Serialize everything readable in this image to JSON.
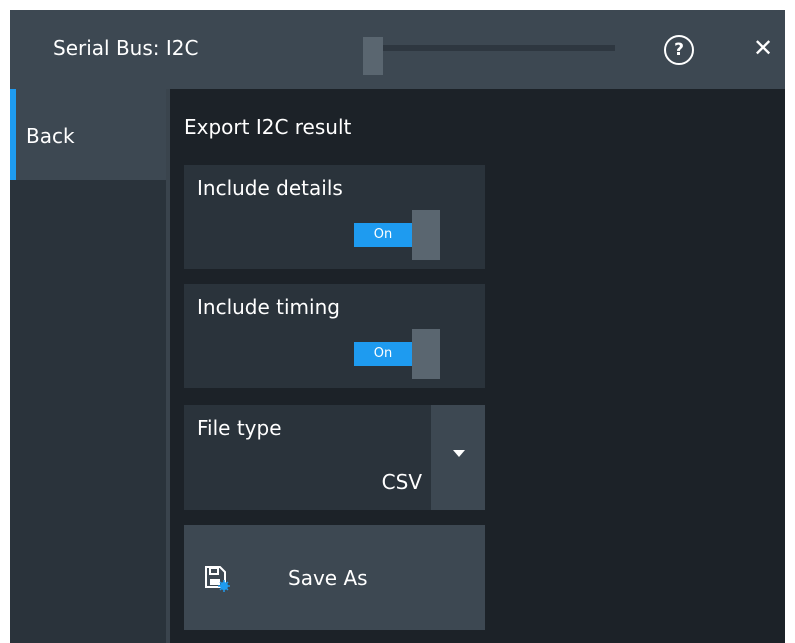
{
  "dialog": {
    "title": "Serial Bus: I2C",
    "help_icon": "help-icon",
    "help_glyph": "?",
    "close_icon": "close-icon",
    "close_glyph": "✕"
  },
  "nav": {
    "back_label": "Back"
  },
  "export": {
    "section_title": "Export I2C result",
    "include_details": {
      "label": "Include details",
      "state": "On"
    },
    "include_timing": {
      "label": "Include timing",
      "state": "On"
    },
    "file_type": {
      "label": "File type",
      "value": "CSV"
    },
    "save_as": {
      "label": "Save As",
      "icon": "save-icon"
    }
  },
  "colors": {
    "accent": "#1e9bf0",
    "background": "#1c2228",
    "panel": "#2a333b",
    "button": "#3d4852"
  }
}
